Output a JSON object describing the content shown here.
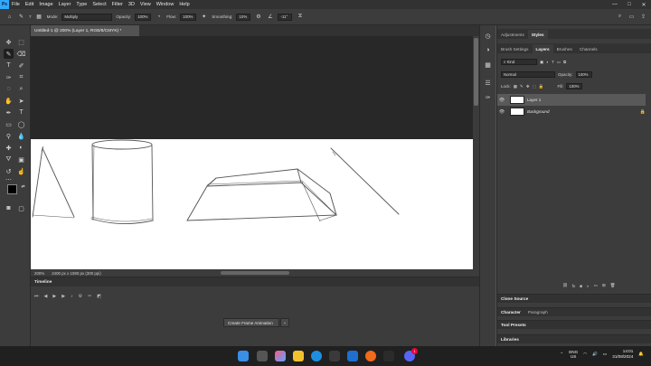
{
  "app": {
    "logo": "Ps"
  },
  "menu": [
    "File",
    "Edit",
    "Image",
    "Layer",
    "Type",
    "Select",
    "Filter",
    "3D",
    "View",
    "Window",
    "Help"
  ],
  "window_controls": {
    "minimize": "—",
    "maximize": "□",
    "close": "✕"
  },
  "options_bar": {
    "mode_label": "Mode:",
    "mode_value": "Multiply",
    "opacity_label": "Opacity:",
    "opacity_value": "100%",
    "flow_label": "Flow:",
    "flow_value": "100%",
    "smoothing_label": "Smoothing:",
    "smoothing_value": "10%",
    "angle_value": "-11°",
    "brush_size": "7"
  },
  "document": {
    "tab_title": "Untitled-1 @ 200% (Layer 1, RGB/8/CMYK) *",
    "zoom": "200%",
    "doc_info": "2400 px x 1080 px (300 ppi)"
  },
  "timeline": {
    "title": "Timeline",
    "create_button": "Create Frame Animation"
  },
  "panels": {
    "top_tabs": [
      {
        "label": "Adjustments",
        "active": false
      },
      {
        "label": "Styles",
        "active": true
      }
    ],
    "layer_tabs": [
      {
        "label": "Brush Settings",
        "active": false
      },
      {
        "label": "Layers",
        "active": true
      },
      {
        "label": "Brushes",
        "active": false
      },
      {
        "label": "Channels",
        "active": false
      }
    ],
    "kind_filter": "Kind",
    "blend_mode": "Normal",
    "opacity_label": "Opacity:",
    "opacity_value": "100%",
    "lock_label": "Lock:",
    "fill_label": "Fill:",
    "fill_value": "100%",
    "layers": [
      {
        "name": "Layer 1",
        "selected": true
      },
      {
        "name": "Background",
        "selected": false
      }
    ],
    "collapsed": [
      "Clone Source",
      "Character",
      "Paragraph",
      "Tool Presets",
      "Libraries"
    ]
  },
  "taskbar": {
    "language": "ENG",
    "region": "US",
    "time": "14:01",
    "date": "31/08/2024",
    "notification_count": "1"
  },
  "colors": {
    "ps_blue": "#31a8ff",
    "foreground": "#000000",
    "background": "#ffffff"
  }
}
